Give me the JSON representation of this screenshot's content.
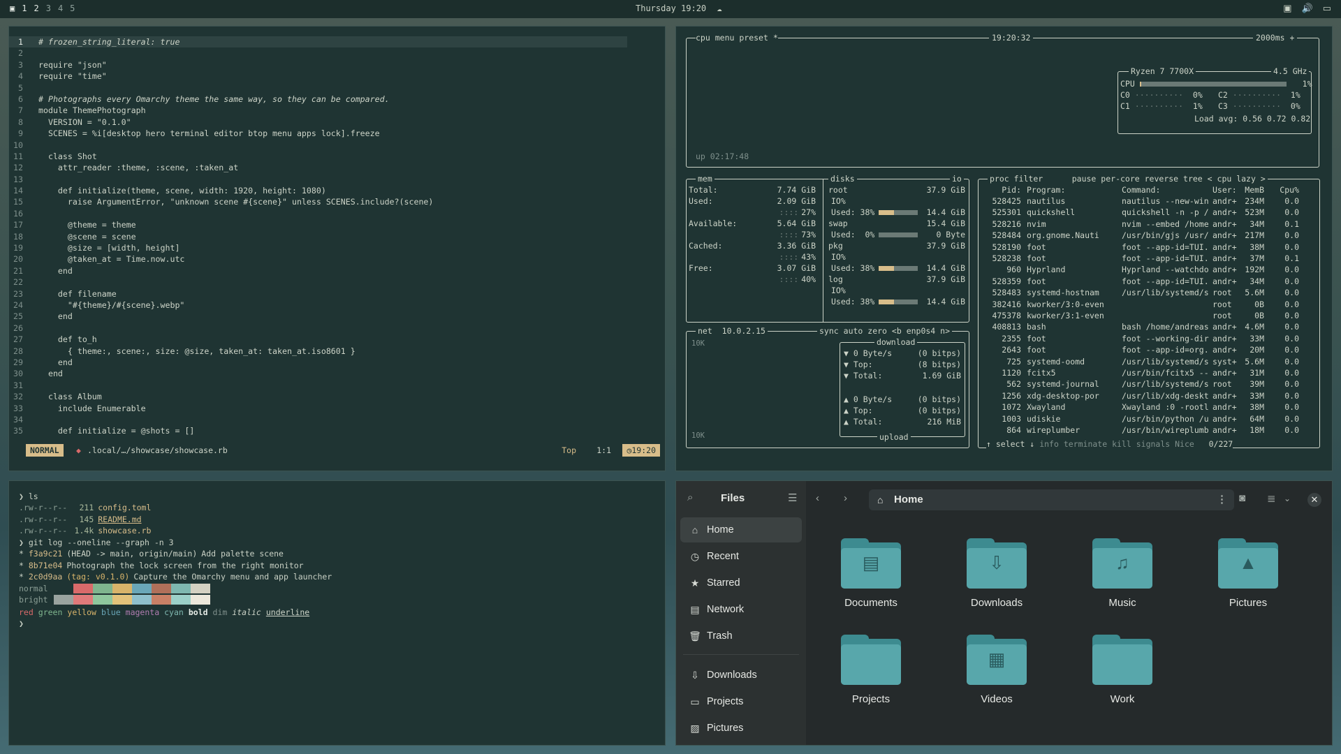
{
  "topbar": {
    "workspaces": [
      "1",
      "2",
      "3",
      "4",
      "5"
    ],
    "active_workspace": "1",
    "clock": "Thursday 19:20"
  },
  "editor": {
    "lines": [
      {
        "n": "1",
        "t": "# frozen_string_literal: true"
      },
      {
        "n": "2",
        "t": ""
      },
      {
        "n": "3",
        "t": "require \"json\""
      },
      {
        "n": "4",
        "t": "require \"time\""
      },
      {
        "n": "5",
        "t": ""
      },
      {
        "n": "6",
        "t": "# Photographs every Omarchy theme the same way, so they can be compared."
      },
      {
        "n": "7",
        "t": "module ThemePhotograph"
      },
      {
        "n": "8",
        "t": "  VERSION = \"0.1.0\""
      },
      {
        "n": "9",
        "t": "  SCENES = %i[desktop hero terminal editor btop menu apps lock].freeze"
      },
      {
        "n": "10",
        "t": ""
      },
      {
        "n": "11",
        "t": "  class Shot"
      },
      {
        "n": "12",
        "t": "    attr_reader :theme, :scene, :taken_at"
      },
      {
        "n": "13",
        "t": ""
      },
      {
        "n": "14",
        "t": "    def initialize(theme, scene, width: 1920, height: 1080)"
      },
      {
        "n": "15",
        "t": "      raise ArgumentError, \"unknown scene #{scene}\" unless SCENES.include?(scene)"
      },
      {
        "n": "16",
        "t": ""
      },
      {
        "n": "17",
        "t": "      @theme = theme"
      },
      {
        "n": "18",
        "t": "      @scene = scene"
      },
      {
        "n": "19",
        "t": "      @size = [width, height]"
      },
      {
        "n": "20",
        "t": "      @taken_at = Time.now.utc"
      },
      {
        "n": "21",
        "t": "    end"
      },
      {
        "n": "22",
        "t": ""
      },
      {
        "n": "23",
        "t": "    def filename"
      },
      {
        "n": "24",
        "t": "      \"#{theme}/#{scene}.webp\""
      },
      {
        "n": "25",
        "t": "    end"
      },
      {
        "n": "26",
        "t": ""
      },
      {
        "n": "27",
        "t": "    def to_h"
      },
      {
        "n": "28",
        "t": "      { theme:, scene:, size: @size, taken_at: taken_at.iso8601 }"
      },
      {
        "n": "29",
        "t": "    end"
      },
      {
        "n": "30",
        "t": "  end"
      },
      {
        "n": "31",
        "t": ""
      },
      {
        "n": "32",
        "t": "  class Album"
      },
      {
        "n": "33",
        "t": "    include Enumerable"
      },
      {
        "n": "34",
        "t": ""
      },
      {
        "n": "35",
        "t": "    def initialize = @shots = []"
      }
    ],
    "status": {
      "mode": "NORMAL",
      "file": ".local/…/showcase/showcase.rb",
      "position": "Top",
      "rowcol": "1:1",
      "time": "19:20"
    }
  },
  "btop": {
    "cpu_header": {
      "tabs": [
        "cpu",
        "menu",
        "preset *"
      ],
      "time": "19:20:32",
      "interval": "2000ms +"
    },
    "uptime": "up 02:17:48",
    "cpu": {
      "model": "Ryzen 7 7700X",
      "freq": "4.5 GHz",
      "total": {
        "label": "CPU",
        "pct": "1%",
        "fill": 0.01
      },
      "cores": [
        {
          "label": "C0",
          "pct": "0%"
        },
        {
          "label": "C2",
          "pct": "1%"
        },
        {
          "label": "C1",
          "pct": "1%"
        },
        {
          "label": "C3",
          "pct": "0%"
        }
      ],
      "load": "Load avg: 0.56 0.72 0.82"
    },
    "mem": {
      "title": "mem",
      "rows": [
        {
          "label": "Total:",
          "value": "7.74 GiB"
        },
        {
          "label": "Used:",
          "value": "2.09 GiB",
          "pct": "27%"
        },
        {
          "label": "Available:",
          "value": "5.64 GiB",
          "pct": "73%"
        },
        {
          "label": "Cached:",
          "value": "3.36 GiB",
          "pct": "43%"
        },
        {
          "label": "Free:",
          "value": "3.07 GiB",
          "pct": "40%"
        }
      ]
    },
    "disks": {
      "title": "disks",
      "io": "io",
      "items": [
        {
          "name": "root",
          "size": "37.9 GiB",
          "io": "IO%",
          "used": "Used: 38%",
          "used_val": "14.4 GiB",
          "fill": 0.38
        },
        {
          "name": "swap",
          "size": "15.4 GiB",
          "io": "",
          "used": "Used:  0%",
          "used_val": "0 Byte",
          "fill": 0.0
        },
        {
          "name": "pkg",
          "size": "37.9 GiB",
          "io": "IO%",
          "used": "Used: 38%",
          "used_val": "14.4 GiB",
          "fill": 0.38
        },
        {
          "name": "log",
          "size": "37.9 GiB",
          "io": "IO%",
          "used": "Used: 38%",
          "used_val": "14.4 GiB",
          "fill": 0.38
        }
      ]
    },
    "net": {
      "title": "net",
      "ip": "10.0.2.15",
      "tabs": [
        "sync",
        "auto",
        "zero",
        "<b enp0s4 n>"
      ],
      "scale": "10K",
      "download": {
        "label": "download",
        "rows": [
          [
            "▼ 0 Byte/s",
            "(0 bitps)"
          ],
          [
            "▼ Top:",
            "(8 bitps)"
          ],
          [
            "▼ Total:",
            "1.69 GiB"
          ]
        ]
      },
      "upload": {
        "label": "upload",
        "rows": [
          [
            "▲ 0 Byte/s",
            "(0 bitps)"
          ],
          [
            "▲ Top:",
            "(0 bitps)"
          ],
          [
            "▲ Total:",
            "216 MiB"
          ]
        ]
      }
    },
    "proc": {
      "title": "proc",
      "tabs": [
        "filter",
        "pause",
        "per-core",
        "reverse",
        "tree",
        "< cpu lazy >"
      ],
      "headers": [
        "Pid:",
        "Program:",
        "Command:",
        "User:",
        "MemB",
        "Cpu%"
      ],
      "rows": [
        [
          "528425",
          "nautilus",
          "nautilus --new-win",
          "andr+",
          "234M",
          "0.0"
        ],
        [
          "525301",
          "quickshell",
          "quickshell -n -p /",
          "andr+",
          "523M",
          "0.0"
        ],
        [
          "528216",
          "nvim",
          "nvim --embed /home",
          "andr+",
          "34M",
          "0.1"
        ],
        [
          "528484",
          "org.gnome.Nauti",
          "/usr/bin/gjs /usr/",
          "andr+",
          "217M",
          "0.0"
        ],
        [
          "528190",
          "foot",
          "foot --app-id=TUI.",
          "andr+",
          "38M",
          "0.0"
        ],
        [
          "528238",
          "foot",
          "foot --app-id=TUI.",
          "andr+",
          "37M",
          "0.1"
        ],
        [
          "960",
          "Hyprland",
          "Hyprland --watchdo",
          "andr+",
          "192M",
          "0.0"
        ],
        [
          "528359",
          "foot",
          "foot --app-id=TUI.",
          "andr+",
          "34M",
          "0.0"
        ],
        [
          "528483",
          "systemd-hostnam",
          "/usr/lib/systemd/s",
          "root",
          "5.6M",
          "0.0"
        ],
        [
          "382416",
          "kworker/3:0-even",
          "",
          "root",
          "0B",
          "0.0"
        ],
        [
          "475378",
          "kworker/3:1-even",
          "",
          "root",
          "0B",
          "0.0"
        ],
        [
          "408813",
          "bash",
          "bash /home/andreas",
          "andr+",
          "4.6M",
          "0.0"
        ],
        [
          "2355",
          "foot",
          "foot --working-dir",
          "andr+",
          "33M",
          "0.0"
        ],
        [
          "2643",
          "foot",
          "foot --app-id=org.",
          "andr+",
          "20M",
          "0.0"
        ],
        [
          "725",
          "systemd-oomd",
          "/usr/lib/systemd/s",
          "syst+",
          "5.6M",
          "0.0"
        ],
        [
          "1120",
          "fcitx5",
          "/usr/bin/fcitx5 --",
          "andr+",
          "31M",
          "0.0"
        ],
        [
          "562",
          "systemd-journal",
          "/usr/lib/systemd/s",
          "root",
          "39M",
          "0.0"
        ],
        [
          "1256",
          "xdg-desktop-por",
          "/usr/lib/xdg-deskt",
          "andr+",
          "33M",
          "0.0"
        ],
        [
          "1072",
          "Xwayland",
          "Xwayland :0 -rootl",
          "andr+",
          "38M",
          "0.0"
        ],
        [
          "1003",
          "udiskie",
          "/usr/bin/python /u",
          "andr+",
          "64M",
          "0.0"
        ],
        [
          "864",
          "wireplumber",
          "/usr/bin/wireplumb",
          "andr+",
          "18M",
          "0.0"
        ]
      ],
      "footer": [
        "↑ select ↓",
        "info",
        "terminate",
        "kill",
        "signals",
        "Nice",
        "0/227"
      ]
    }
  },
  "terminal": {
    "prompt1": "❯ ls",
    "files": [
      {
        "perm": ".rw-r--r--",
        "size": "211",
        "name": "config.toml"
      },
      {
        "perm": ".rw-r--r--",
        "size": "145",
        "name": "README.md"
      },
      {
        "perm": ".rw-r--r--",
        "size": "1.4k",
        "name": "showcase.rb"
      }
    ],
    "prompt2": "❯ git log --oneline --graph -n 3",
    "commits": [
      {
        "hash": "f3a9c21",
        "ref": "(HEAD -> main, origin/main)",
        "msg": "Add palette scene"
      },
      {
        "hash": "8b71e04",
        "ref": "",
        "msg": "Photograph the lock screen from the right monitor"
      },
      {
        "hash": "2c0d9aa",
        "ref": "(tag: v0.1.0)",
        "msg": "Capture the Omarchy menu and app launcher"
      }
    ],
    "palette_labels": [
      "normal",
      "bright"
    ],
    "normal_colors": [
      "#1f3433",
      "#d96a6a",
      "#7fb58e",
      "#d8b46a",
      "#6aa7b8",
      "#b0705a",
      "#7fb8b0",
      "#d4d1c2"
    ],
    "bright_colors": [
      "#9aa39f",
      "#e07a7a",
      "#8fc79d",
      "#e2c27a",
      "#8fc0cc",
      "#c98066",
      "#9cd0c8",
      "#ece8db"
    ],
    "styles": [
      "red",
      "green",
      "yellow",
      "blue",
      "magenta",
      "cyan",
      "bold",
      "dim",
      "italic",
      "underline"
    ],
    "prompt3": "❯"
  },
  "files": {
    "title": "Files",
    "path": "Home",
    "sidebar": [
      {
        "label": "Home",
        "icon": "home-icon"
      },
      {
        "label": "Recent",
        "icon": "clock-icon"
      },
      {
        "label": "Starred",
        "icon": "star-icon"
      },
      {
        "label": "Network",
        "icon": "network-icon"
      },
      {
        "label": "Trash",
        "icon": "trash-icon"
      }
    ],
    "bookmarks": [
      {
        "label": "Downloads",
        "icon": "download-icon"
      },
      {
        "label": "Projects",
        "icon": "folder-icon"
      },
      {
        "label": "Pictures",
        "icon": "image-icon"
      }
    ],
    "folders": [
      {
        "label": "Documents",
        "glyph": "▤"
      },
      {
        "label": "Downloads",
        "glyph": "⇩"
      },
      {
        "label": "Music",
        "glyph": "♫"
      },
      {
        "label": "Pictures",
        "glyph": "▲"
      },
      {
        "label": "Projects",
        "glyph": ""
      },
      {
        "label": "Videos",
        "glyph": "▦"
      },
      {
        "label": "Work",
        "glyph": ""
      }
    ]
  }
}
